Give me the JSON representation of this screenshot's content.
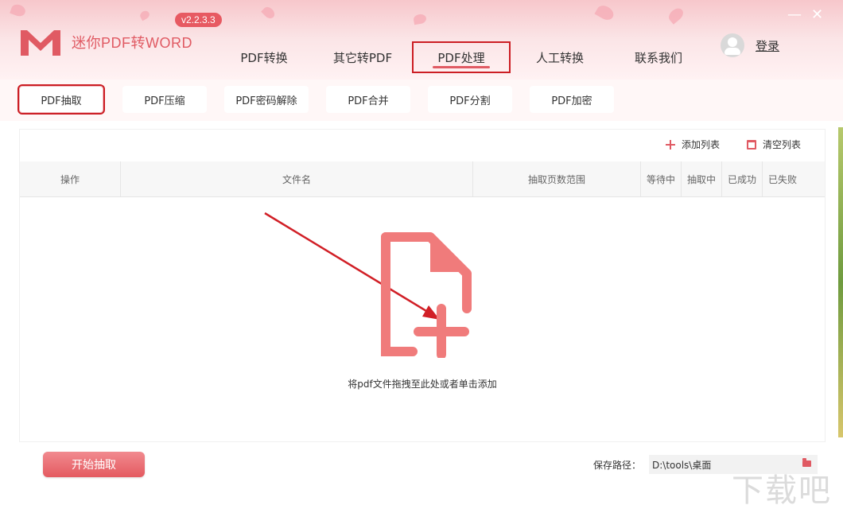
{
  "app": {
    "title": "迷你PDF转WORD",
    "version": "v2.2.3.3"
  },
  "nav": {
    "items": [
      "PDF转换",
      "其它转PDF",
      "PDF处理",
      "人工转换",
      "联系我们"
    ],
    "active": "PDF处理"
  },
  "user": {
    "login": "登录"
  },
  "window_controls": {
    "minimize": "—",
    "close": "✕"
  },
  "subtabs": {
    "items": [
      "PDF抽取",
      "PDF压缩",
      "PDF密码解除",
      "PDF合并",
      "PDF分割",
      "PDF加密"
    ],
    "active": "PDF抽取"
  },
  "list_actions": {
    "add": "添加列表",
    "clear": "清空列表"
  },
  "table": {
    "headers": [
      "操作",
      "文件名",
      "抽取页数范围",
      "等待中",
      "抽取中",
      "已成功",
      "已失败"
    ]
  },
  "dropzone": {
    "text": "将pdf文件拖拽至此处或者单击添加"
  },
  "footer": {
    "start_button": "开始抽取",
    "save_label": "保存路径：",
    "save_path": "D:\\tools\\桌面"
  },
  "colors": {
    "accent": "#e05a63",
    "highlight_outline": "#cc1d23"
  },
  "watermark": "下载吧"
}
